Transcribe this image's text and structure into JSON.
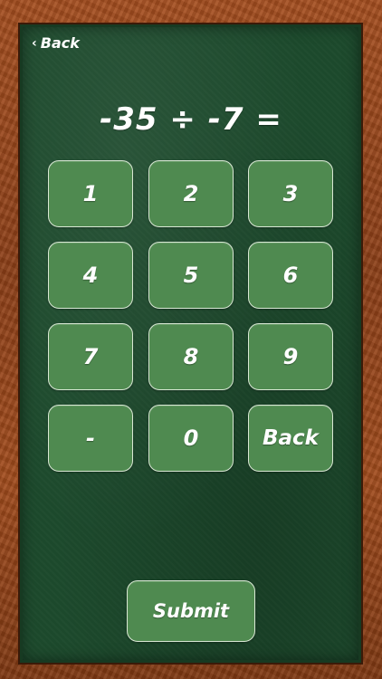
{
  "nav": {
    "back_label": "Back",
    "back_icon": "chevron-left-icon"
  },
  "problem": {
    "equation": "-35 ÷ -7 ="
  },
  "keypad": {
    "keys": [
      "1",
      "2",
      "3",
      "4",
      "5",
      "6",
      "7",
      "8",
      "9",
      "-",
      "0",
      "Back"
    ]
  },
  "submit_label": "Submit",
  "colors": {
    "frame_wood": "#8c3f17",
    "board_green": "#1d4a2d",
    "key_green": "#4f8a50",
    "key_border": "#d8e8d4",
    "text": "#ffffff"
  }
}
